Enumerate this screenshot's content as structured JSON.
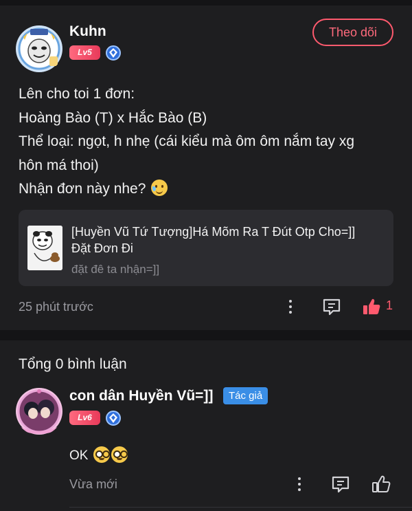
{
  "post": {
    "author": "Kuhn",
    "level": "Lv5",
    "follow_label": "Theo dõi",
    "body_lines": [
      "Lên cho toi 1 đơn:",
      "Hoàng Bào (T) x Hắc Bào (B)",
      "Thể loại: ngọt, h nhẹ (cái kiểu mà ôm ôm nắm tay xg",
      "hôn má thoi)",
      "Nhận đơn này nhe?"
    ],
    "link_card": {
      "title_line1": "[Huyền Vũ Tứ Tượng]Há Mõm Ra T Đút Otp Cho=]]",
      "title_line2": "Đặt Đơn Đi",
      "subtitle": "đặt đê ta nhận=]]"
    },
    "time": "25 phút trước",
    "like_count": "1"
  },
  "comments_section": {
    "total_label": "Tổng 0 bình luận"
  },
  "comment": {
    "author": "con dân Huyền Vũ=]]",
    "author_tag": "Tác giả",
    "level": "Lv6",
    "text": "OK",
    "time": "Vừa mới"
  },
  "colors": {
    "background": "#1e1e20",
    "accent": "#ff5a6e",
    "author_tag": "#3a8ee6",
    "muted_text": "#9a9aa0"
  },
  "icons": [
    "more-vertical-icon",
    "comment-icon",
    "thumbs-up-icon",
    "verified-shield-icon",
    "emoji-tear-smile-icon",
    "emoji-nerd-icon"
  ]
}
